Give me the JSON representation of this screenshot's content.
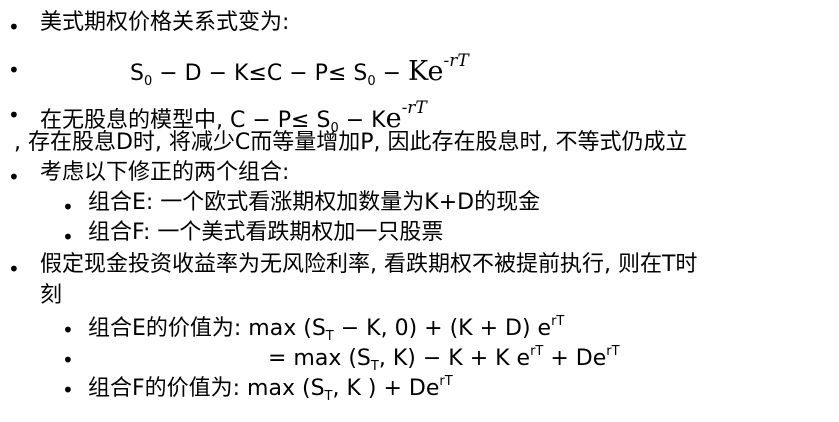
{
  "lines": {
    "l1": "美式期权价格关系式变为:",
    "l2": {
      "a": "S",
      "b": "0",
      "c": " − D − K≤C − P≤ S",
      "d": "0",
      "e": " − ",
      "f": "K",
      "g": "e",
      "h": "-rT"
    },
    "l3": {
      "a": "在无股息的模型中, C − P≤ S",
      "b": "0",
      "c": " − K",
      "d": "e",
      "e": "-rT"
    },
    "l4": ", 存在股息D时, 将减少C而等量增加P, 因此存在股息时, 不等式仍成立",
    "l5": "考虑以下修正的两个组合:",
    "l6": "组合E: 一个欧式看涨期权加数量为K+D的现金",
    "l7": "组合F: 一个美式看跌期权加一只股票",
    "l8": "假定现金投资收益率为无风险利率, 看跌期权不被提前执行, 则在T时",
    "l8b": "刻",
    "l9": {
      "a": "组合E的价值为: max (S",
      "b": "T",
      "c": " − K, 0) + (K + D) e",
      "d": "rT"
    },
    "l10": {
      "a": "= max (S",
      "b": "T",
      "c": ", K) − K + K e",
      "d": "rT",
      "e": " + De",
      "f": "rT"
    },
    "l11": {
      "a": "组合F的价值为: max (S",
      "b": "T",
      "c": ", K ) + De",
      "d": "rT"
    }
  },
  "bullets": {
    "main": "•",
    "sub": "•"
  }
}
